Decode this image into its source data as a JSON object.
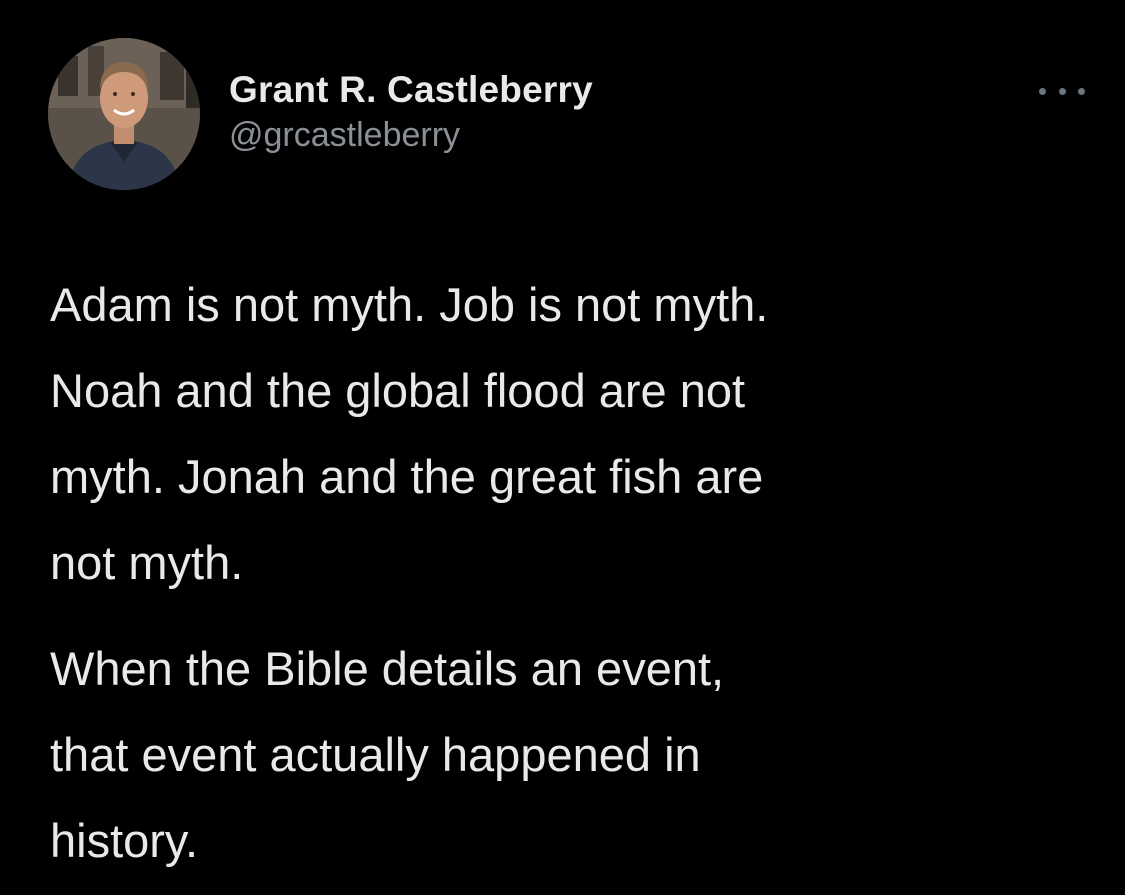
{
  "author": {
    "display_name": "Grant R. Castleberry",
    "handle": "@grcastleberry"
  },
  "avatar_icon": "profile-photo",
  "more_icon": "more-horizontal-icon",
  "tweet": {
    "paragraphs": [
      {
        "lines": [
          "Adam is not myth. Job is not myth.",
          "Noah and the global flood are not",
          "myth. Jonah and the great fish are",
          "not myth."
        ]
      },
      {
        "lines": [
          "When the Bible details an event,",
          "that event actually happened in",
          "history."
        ]
      }
    ]
  },
  "colors": {
    "background": "#000000",
    "text_primary": "#e7e9ea",
    "text_secondary": "#8b9096",
    "icon_muted": "#6e767d"
  }
}
